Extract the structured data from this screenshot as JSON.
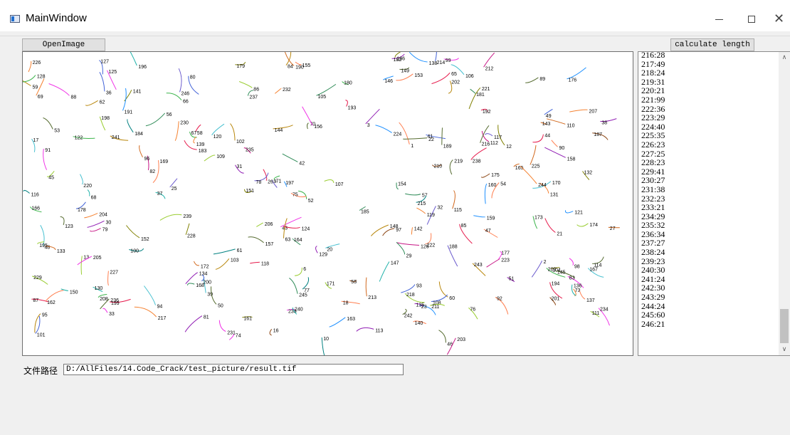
{
  "window": {
    "title": "MainWindow"
  },
  "toolbar": {
    "open_label": "OpenImage",
    "calc_label": "calculate length"
  },
  "path": {
    "label": "文件路径",
    "value": "D:/AllFiles/14.Code_Crack/test_picture/result.tif"
  },
  "results": [
    "216:28",
    "217:49",
    "218:24",
    "219:31",
    "220:21",
    "221:99",
    "222:36",
    "223:29",
    "224:40",
    "225:35",
    "226:23",
    "227:25",
    "228:23",
    "229:41",
    "230:27",
    "231:38",
    "232:23",
    "233:21",
    "234:29",
    "235:32",
    "236:34",
    "237:27",
    "238:24",
    "239:23",
    "240:30",
    "241:24",
    "242:30",
    "243:29",
    "244:24",
    "245:60",
    "246:21"
  ],
  "crack_labels": [
    "1",
    "2",
    "3",
    "6",
    "9",
    "10",
    "12",
    "13",
    "16",
    "17",
    "18",
    "20",
    "21",
    "22",
    "23",
    "25",
    "26",
    "27",
    "29",
    "30",
    "31",
    "32",
    "33",
    "36",
    "37",
    "38",
    "39",
    "41",
    "42",
    "43",
    "44",
    "45",
    "46",
    "47",
    "48",
    "49",
    "50",
    "51",
    "52",
    "53",
    "54",
    "55",
    "56",
    "57",
    "58",
    "59",
    "60",
    "61",
    "62",
    "63",
    "65",
    "66",
    "67",
    "68",
    "69",
    "70",
    "71",
    "73",
    "74",
    "75",
    "76",
    "77",
    "78",
    "79",
    "80",
    "81",
    "82",
    "83",
    "84",
    "85",
    "86",
    "87",
    "88",
    "89",
    "90",
    "91",
    "92",
    "93",
    "94",
    "95",
    "96",
    "97",
    "98",
    "99",
    "100",
    "101",
    "102",
    "103",
    "104",
    "105",
    "106",
    "107",
    "108",
    "109",
    "110",
    "111",
    "112",
    "113",
    "114",
    "115",
    "116",
    "117",
    "118",
    "119",
    "120",
    "121",
    "122",
    "123",
    "124",
    "125",
    "126",
    "127",
    "128",
    "129",
    "130",
    "131",
    "132",
    "133",
    "134",
    "135",
    "136",
    "137",
    "138",
    "139",
    "140",
    "141",
    "142",
    "143",
    "144",
    "145",
    "146",
    "147",
    "148",
    "149",
    "150",
    "151",
    "152",
    "153",
    "154",
    "155",
    "156",
    "157",
    "158",
    "159",
    "160",
    "161",
    "162",
    "163",
    "164",
    "165",
    "166",
    "167",
    "168",
    "169",
    "170",
    "171",
    "172",
    "173",
    "174",
    "175",
    "176",
    "177",
    "178",
    "179",
    "180",
    "181",
    "182",
    "183",
    "184",
    "185",
    "186",
    "187",
    "188",
    "189",
    "190",
    "191",
    "192",
    "193",
    "194",
    "195",
    "196",
    "197",
    "198",
    "199",
    "200",
    "201",
    "202",
    "203",
    "204",
    "205",
    "206",
    "207",
    "208",
    "209",
    "210",
    "211",
    "212",
    "213",
    "214",
    "215",
    "216",
    "217",
    "218",
    "219",
    "220",
    "221",
    "222",
    "223",
    "224",
    "225",
    "226",
    "227",
    "228",
    "229",
    "230",
    "231",
    "232",
    "233",
    "234",
    "235",
    "236",
    "237",
    "238",
    "239",
    "240",
    "241",
    "242",
    "243",
    "244",
    "245",
    "246"
  ],
  "crack_colors": [
    "#e6194b",
    "#3cb44b",
    "#4363d8",
    "#f58231",
    "#911eb4",
    "#46c0d0",
    "#f032e6",
    "#9acd32",
    "#8b4513",
    "#008080",
    "#808000",
    "#1e90ff",
    "#ff7f50",
    "#2e8b57",
    "#c71585",
    "#556b2f",
    "#6a5acd",
    "#d2691e",
    "#20b2aa",
    "#b8860b"
  ],
  "icons": {
    "app": "app-window-icon",
    "minimize": "minimize-icon",
    "maximize": "maximize-icon",
    "close": "close-icon",
    "scroll_up": "chevron-up-icon",
    "scroll_down": "chevron-down-icon"
  }
}
